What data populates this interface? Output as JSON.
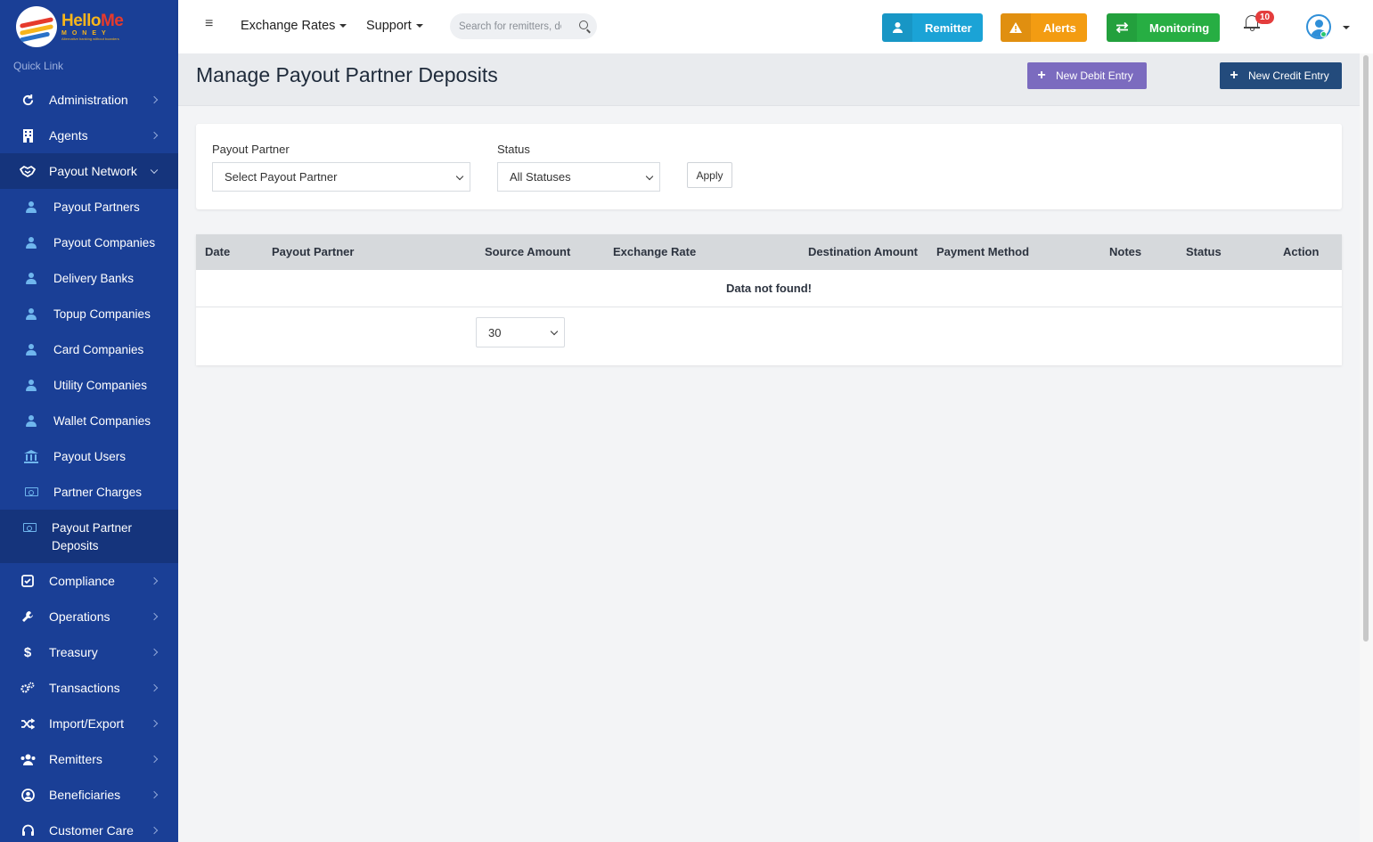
{
  "logo": {
    "brand_part1": "Hello",
    "brand_part2": "Me",
    "sub": "MONEY",
    "tagline": "Alternative banking without boarders"
  },
  "sidebar": {
    "quick_link": "Quick Link",
    "items": [
      {
        "label": "Administration",
        "icon": "refresh-icon"
      },
      {
        "label": "Agents",
        "icon": "building-icon"
      },
      {
        "label": "Payout Network",
        "icon": "handshake-icon"
      }
    ],
    "sub_items": [
      {
        "label": "Payout Partners",
        "icon": "user-icon"
      },
      {
        "label": "Payout Companies",
        "icon": "user-icon"
      },
      {
        "label": "Delivery Banks",
        "icon": "user-icon"
      },
      {
        "label": "Topup Companies",
        "icon": "user-icon"
      },
      {
        "label": "Card Companies",
        "icon": "user-icon"
      },
      {
        "label": "Utility Companies",
        "icon": "user-icon"
      },
      {
        "label": "Wallet Companies",
        "icon": "user-icon"
      },
      {
        "label": "Payout Users",
        "icon": "bank-icon"
      },
      {
        "label": "Partner Charges",
        "icon": "money-icon"
      },
      {
        "label": "Payout Partner Deposits",
        "icon": "money-icon"
      }
    ],
    "items_after": [
      {
        "label": "Compliance",
        "icon": "check-square-icon"
      },
      {
        "label": "Operations",
        "icon": "wrench-icon"
      },
      {
        "label": "Treasury",
        "icon": "dollar-icon"
      },
      {
        "label": "Transactions",
        "icon": "cogs-icon"
      },
      {
        "label": "Import/Export",
        "icon": "shuffle-icon"
      },
      {
        "label": "Remitters",
        "icon": "users-icon"
      },
      {
        "label": "Beneficiaries",
        "icon": "user-circle-icon"
      },
      {
        "label": "Customer Care",
        "icon": "headset-icon"
      }
    ]
  },
  "header": {
    "menu1": "Exchange Rates",
    "menu2": "Support",
    "search_placeholder": "Search for remitters, documents",
    "btn_remitter": "Remitter",
    "btn_alerts": "Alerts",
    "btn_monitoring": "Monitoring",
    "notification_count": "10",
    "colors": {
      "remitter": "#1ba3d6",
      "alerts": "#f39c12",
      "monitoring": "#27ae43",
      "debit": "#7b6bbf",
      "credit": "#234b7c"
    }
  },
  "page": {
    "title": "Manage Payout Partner Deposits",
    "new_debit": "New Debit Entry",
    "new_credit": "New Credit Entry"
  },
  "filters": {
    "partner_label": "Payout Partner",
    "partner_value": "Select Payout Partner",
    "status_label": "Status",
    "status_value": "All Statuses",
    "apply": "Apply"
  },
  "table": {
    "columns": [
      "Date",
      "Payout Partner",
      "Source Amount",
      "Exchange Rate",
      "Destination Amount",
      "Payment Method",
      "Notes",
      "Status",
      "Action"
    ],
    "empty_message": "Data not found!",
    "page_size": "30"
  }
}
